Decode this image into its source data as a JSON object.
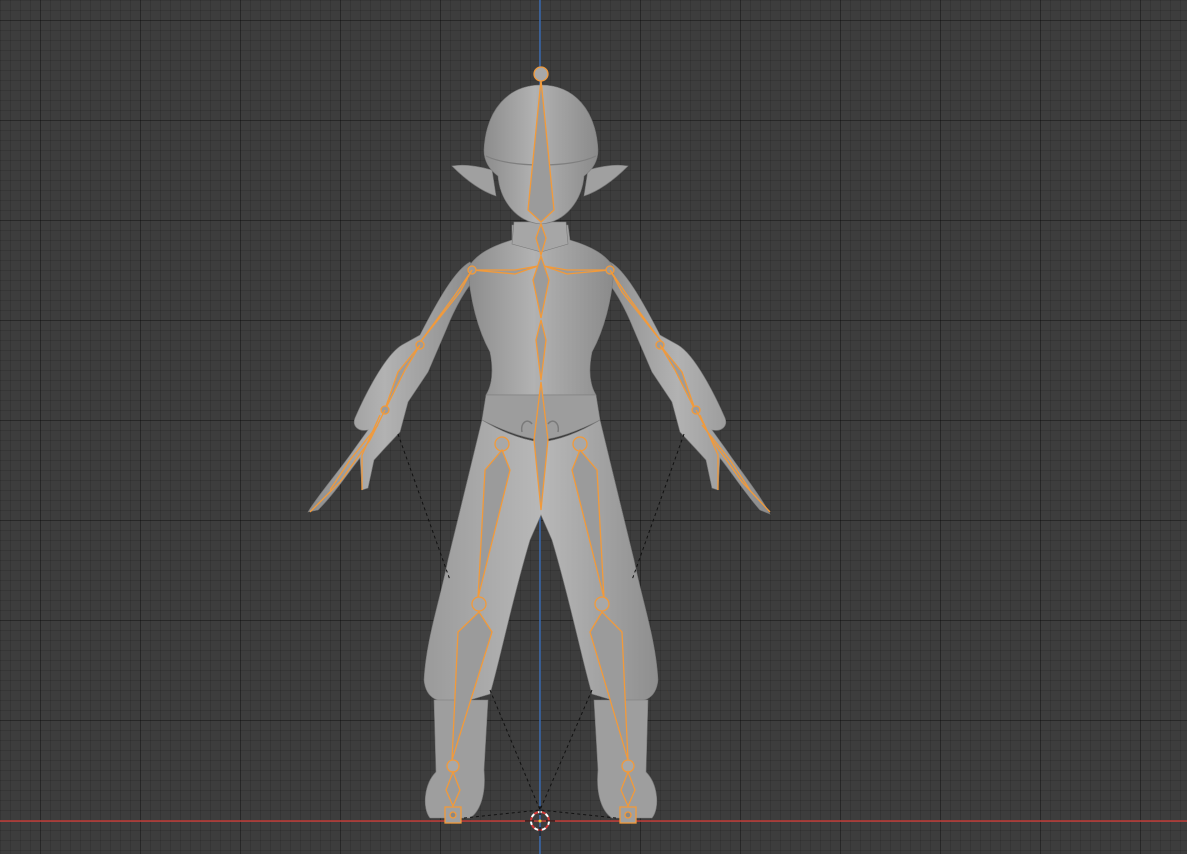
{
  "viewport": {
    "background_color": "#3d3d3d",
    "grid_line_color": "#2e2e2e",
    "x_axis_color": "#c8403c",
    "z_axis_color": "#3f6fb3"
  },
  "model": {
    "mesh_color": "#a9a9a9",
    "mesh_shadow_color": "#8a8a8a",
    "armature_color": "#9a9a9a",
    "selection_outline_color": "#f29a3a",
    "relationship_line_color": "#111111"
  },
  "icons": {
    "origin": "3d-cursor-icon"
  }
}
